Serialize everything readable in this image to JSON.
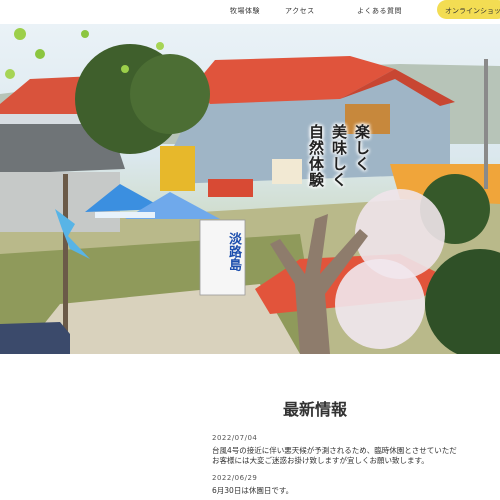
{
  "nav": {
    "items": [
      "牧場体験",
      "アクセス",
      "よくある質問"
    ],
    "shop_label": "オンラインショップ"
  },
  "hero": {
    "catch_columns": [
      "楽しく",
      "美味しく",
      "自然体験"
    ],
    "sign_text": "淡路島"
  },
  "news": {
    "heading": "最新情報",
    "items": [
      {
        "date": "2022/07/04",
        "line1": "台風4号の接近に伴い悪天候が予測されるため、臨時休園とさせていただ",
        "line2": "お客様には大変ご迷惑お掛け致しますが宜しくお願い致します。"
      },
      {
        "date": "2022/06/29",
        "line1": "6月30日は休園日です。",
        "line2": ""
      }
    ]
  },
  "colors": {
    "accent": "#f3dd53",
    "roof": "#e0543c"
  }
}
